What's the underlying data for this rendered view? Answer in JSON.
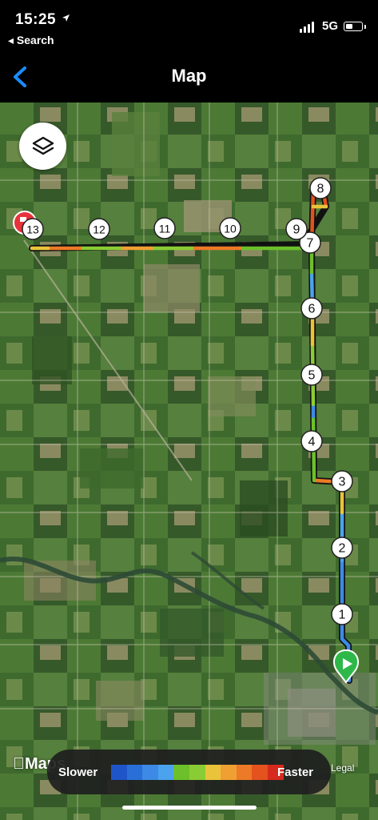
{
  "status_bar": {
    "time": "15:25",
    "back_app": "◂ Search",
    "network": "5G"
  },
  "nav": {
    "title": "Map"
  },
  "map": {
    "markers": [
      "1",
      "2",
      "3",
      "4",
      "5",
      "6",
      "7",
      "8",
      "9",
      "10",
      "11",
      "12",
      "13"
    ],
    "attribution": "Maps",
    "legal": "Legal"
  },
  "legend": {
    "slower_label": "Slower",
    "faster_label": "Faster",
    "colors": [
      "#1e55c8",
      "#2a6fd8",
      "#3c8ae6",
      "#4aa3ec",
      "#6cc02a",
      "#8acc34",
      "#e9c43a",
      "#f0a032",
      "#ec7a26",
      "#e4521e",
      "#d62a1e"
    ]
  },
  "colors": {
    "accent": "#1a8cff",
    "start_marker": "#2fb84a",
    "end_marker": "#e8323c"
  },
  "icons": {
    "back": "chevron-left-icon",
    "layers": "layers-icon",
    "location": "location-arrow-icon"
  }
}
